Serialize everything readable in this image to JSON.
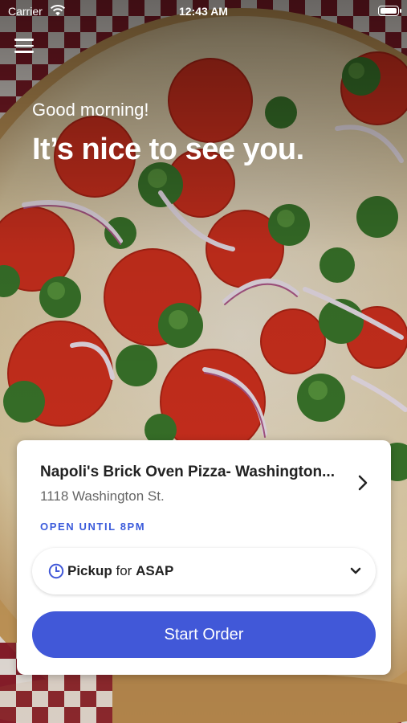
{
  "status_bar": {
    "carrier": "Carrier",
    "time": "12:43 AM"
  },
  "greeting": {
    "salutation": "Good morning!",
    "headline": "It’s nice to see you."
  },
  "store_card": {
    "name": "Napoli's Brick Oven Pizza- Washington...",
    "address": "1118 Washington St.",
    "hours": "OPEN UNTIL 8PM",
    "order_mode": {
      "mode": "Pickup",
      "connector": "for",
      "time": "ASAP"
    },
    "start_button_label": "Start Order"
  },
  "colors": {
    "accent": "#4158d8",
    "hours_text": "#3b5bdb"
  },
  "icons": [
    "menu-icon",
    "wifi-icon",
    "battery-icon",
    "chevron-right-icon",
    "clock-icon",
    "chevron-down-icon"
  ]
}
